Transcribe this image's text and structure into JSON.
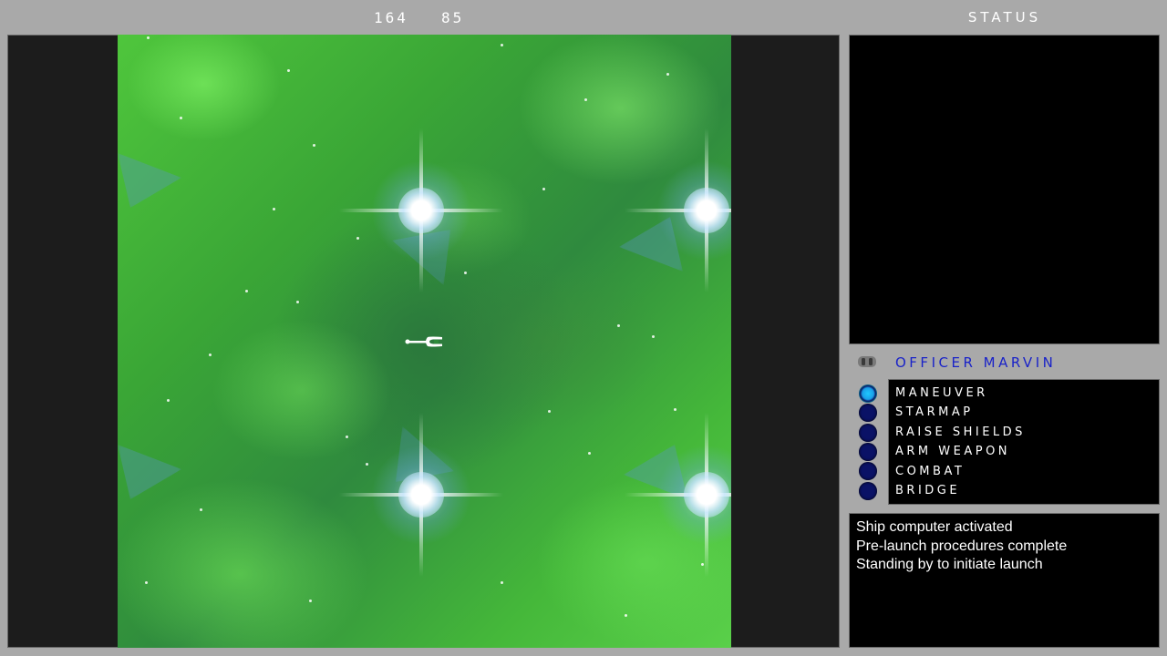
{
  "hud": {
    "coord_x": "164",
    "coord_y": "85"
  },
  "status": {
    "title": "STATUS"
  },
  "officer": {
    "name": "OFFICER MARVIN",
    "icon": "officer-badge-icon"
  },
  "commands": {
    "items": [
      {
        "label": "MANEUVER",
        "active": true
      },
      {
        "label": "STARMAP",
        "active": false
      },
      {
        "label": "RAISE SHIELDS",
        "active": false
      },
      {
        "label": "ARM WEAPON",
        "active": false
      },
      {
        "label": "COMBAT",
        "active": false
      },
      {
        "label": "BRIDGE",
        "active": false
      }
    ]
  },
  "log": {
    "lines": [
      "Ship computer activated",
      "Pre-launch procedures complete",
      "Standing by to initiate launch"
    ]
  },
  "colors": {
    "frame_bg": "#a9a9a9",
    "panel_bg": "#000000",
    "officer_name": "#1a23c8",
    "bullet_inactive": "#0a1266",
    "bullet_active": "#1ec8ff",
    "nebula": "#3aa636"
  }
}
